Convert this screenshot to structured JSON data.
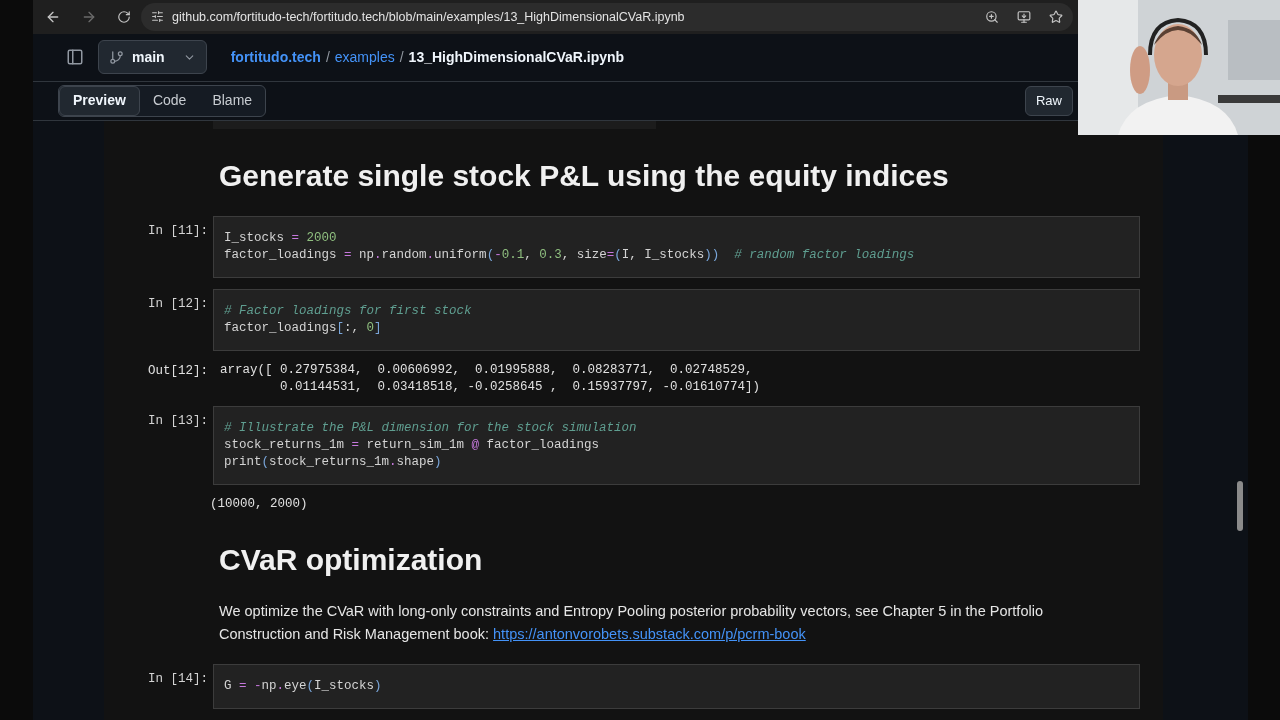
{
  "browser": {
    "url": "github.com/fortitudo-tech/fortitudo.tech/blob/main/examples/13_HighDimensionalCVaR.ipynb"
  },
  "repo_header": {
    "branch": "main",
    "separator": "/",
    "breadcrumb": [
      {
        "text": "fortitudo.tech",
        "link": true
      },
      {
        "text": "examples",
        "link": true
      },
      {
        "text": "13_HighDimensionalCVaR.ipynb",
        "link": false
      }
    ]
  },
  "view_tabs": [
    {
      "label": "Preview",
      "selected": true
    },
    {
      "label": "Code",
      "selected": false
    },
    {
      "label": "Blame",
      "selected": false
    }
  ],
  "raw_button": "Raw",
  "cells": [
    {
      "kind": "heading",
      "text": "Generate single stock P&L using the equity indices"
    },
    {
      "kind": "code",
      "prompt": "In [11]:",
      "lines": [
        [
          {
            "text": "I_stocks ",
            "kind": "plain"
          },
          {
            "text": "=",
            "kind": "op"
          },
          {
            "text": " 2000",
            "kind": "num"
          }
        ],
        [
          {
            "text": "factor_loadings ",
            "kind": "plain"
          },
          {
            "text": "=",
            "kind": "op"
          },
          {
            "text": " np",
            "kind": "plain"
          },
          {
            "text": ".",
            "kind": "op"
          },
          {
            "text": "random",
            "kind": "plain"
          },
          {
            "text": ".",
            "kind": "op"
          },
          {
            "text": "uniform",
            "kind": "plain"
          },
          {
            "text": "(",
            "kind": "punct"
          },
          {
            "text": "-",
            "kind": "op"
          },
          {
            "text": "0.1",
            "kind": "num"
          },
          {
            "text": ", ",
            "kind": "plain"
          },
          {
            "text": "0.3",
            "kind": "num"
          },
          {
            "text": ", size",
            "kind": "plain"
          },
          {
            "text": "=",
            "kind": "op"
          },
          {
            "text": "(",
            "kind": "punct"
          },
          {
            "text": "I, I_stocks",
            "kind": "plain"
          },
          {
            "text": "))",
            "kind": "punct"
          },
          {
            "text": "  # random factor loadings",
            "kind": "comment"
          }
        ]
      ]
    },
    {
      "kind": "code",
      "prompt": "In [12]:",
      "lines": [
        [
          {
            "text": "# Factor loadings for first stock",
            "kind": "comment"
          }
        ],
        [
          {
            "text": "factor_loadings",
            "kind": "plain"
          },
          {
            "text": "[",
            "kind": "punct"
          },
          {
            "text": ":, ",
            "kind": "plain"
          },
          {
            "text": "0",
            "kind": "num"
          },
          {
            "text": "]",
            "kind": "punct"
          }
        ]
      ]
    },
    {
      "kind": "output",
      "prompt": "Out[12]:",
      "lines": [
        "array([ 0.27975384,  0.00606992,  0.01995888,  0.08283771,  0.02748529,",
        "        0.01144531,  0.03418518, -0.0258645 ,  0.15937797, -0.01610774])"
      ]
    },
    {
      "kind": "code",
      "prompt": "In [13]:",
      "lines": [
        [
          {
            "text": "# Illustrate the P&L dimension for the stock simulation",
            "kind": "comment"
          }
        ],
        [
          {
            "text": "stock_returns_1m ",
            "kind": "plain"
          },
          {
            "text": "=",
            "kind": "op"
          },
          {
            "text": " return_sim_1m ",
            "kind": "plain"
          },
          {
            "text": "@",
            "kind": "op"
          },
          {
            "text": " factor_loadings",
            "kind": "plain"
          }
        ],
        [
          {
            "text": "print",
            "kind": "plain"
          },
          {
            "text": "(",
            "kind": "punct"
          },
          {
            "text": "stock_returns_1m",
            "kind": "plain"
          },
          {
            "text": ".",
            "kind": "op"
          },
          {
            "text": "shape",
            "kind": "plain"
          },
          {
            "text": ")",
            "kind": "punct"
          }
        ]
      ]
    },
    {
      "kind": "output",
      "lines": [
        "(10000, 2000)"
      ]
    },
    {
      "kind": "heading",
      "text": "CVaR optimization"
    },
    {
      "kind": "paragraph",
      "text": "We optimize the CVaR with long-only constraints and Entropy Pooling posterior probability vectors, see Chapter 5 in the Portfolio Construction and Risk Management book: ",
      "link": "https://antonvorobets.substack.com/p/pcrm-book"
    },
    {
      "kind": "code",
      "prompt": "In [14]:",
      "lines": [
        [
          {
            "text": "G ",
            "kind": "plain"
          },
          {
            "text": "= -",
            "kind": "op"
          },
          {
            "text": "np",
            "kind": "plain"
          },
          {
            "text": ".",
            "kind": "op"
          },
          {
            "text": "eye",
            "kind": "plain"
          },
          {
            "text": "(",
            "kind": "punct"
          },
          {
            "text": "I_stocks",
            "kind": "plain"
          },
          {
            "text": ")",
            "kind": "punct"
          }
        ]
      ]
    }
  ]
}
